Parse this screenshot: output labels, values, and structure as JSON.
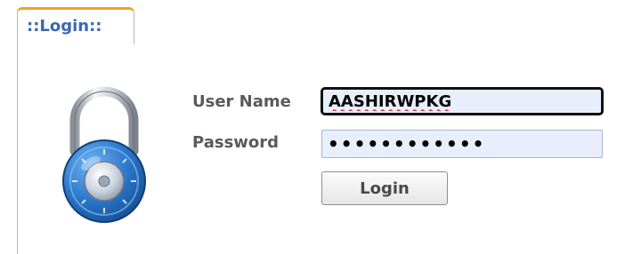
{
  "tab": {
    "label": "::Login::"
  },
  "form": {
    "username_label": "User Name",
    "username_value": "AASHIRWPKG",
    "password_label": "Password",
    "password_value": "••••••••••••",
    "login_button": "Login"
  },
  "icons": {
    "lock": "padlock-icon"
  },
  "colors": {
    "tab_accent": "#f0a21a",
    "tab_text": "#3a67b0",
    "input_bg": "#e8eefb",
    "label_text": "#5a5a5a",
    "lock_dial": "#2f7fd2"
  }
}
